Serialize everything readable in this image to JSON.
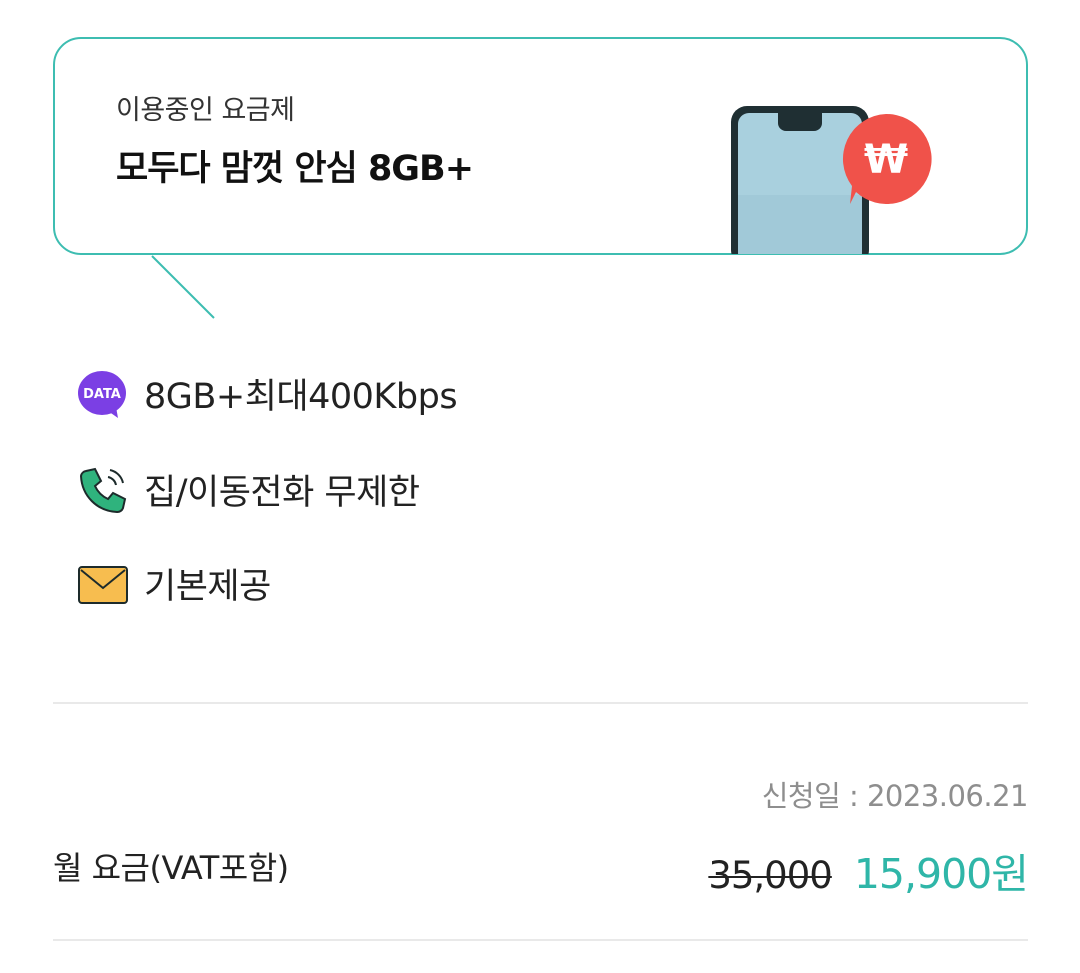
{
  "plan": {
    "caption": "이용중인 요금제",
    "name": "모두다 맘껏 안심 8GB+"
  },
  "illustration": {
    "phone_icon": "smartphone-icon",
    "badge_icon": "won-currency-icon",
    "badge_text": "₩"
  },
  "features": [
    {
      "icon": "data-icon",
      "icon_label": "DATA",
      "text": "8GB+최대400Kbps"
    },
    {
      "icon": "phone-call-icon",
      "text": "집/이동전화 무제한"
    },
    {
      "icon": "message-envelope-icon",
      "text": "기본제공"
    }
  ],
  "fee": {
    "apply_date": "신청일 : 2023.06.21",
    "label": "월 요금(VAT포함)",
    "original_price": "35,000",
    "sale_price": "15,900원"
  },
  "colors": {
    "accent": "#3dbdb1",
    "sale": "#2fb6a8",
    "data_badge": "#7b3fe4",
    "won_badge": "#f0524a",
    "envelope": "#f7bd4f"
  }
}
